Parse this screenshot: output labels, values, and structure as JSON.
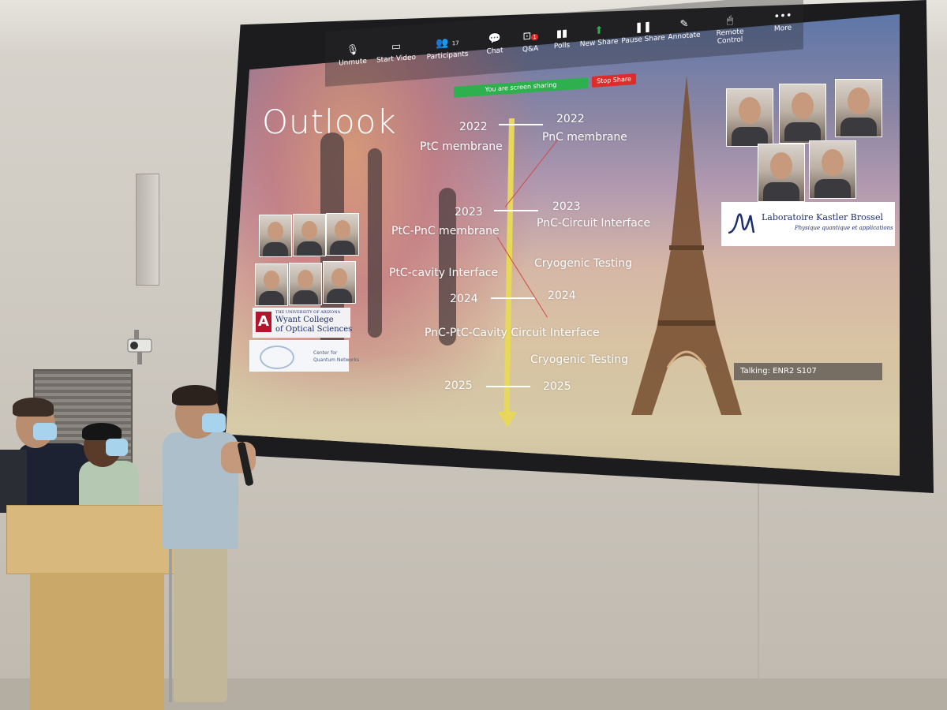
{
  "zoom_toolbar": {
    "items": [
      {
        "label": "Unmute",
        "icon": "mic-muted-icon"
      },
      {
        "label": "Start Video",
        "icon": "video-off-icon"
      },
      {
        "label": "Participants",
        "icon": "participants-icon",
        "count": "17"
      },
      {
        "label": "Chat",
        "icon": "chat-icon"
      },
      {
        "label": "Q&A",
        "icon": "qa-icon",
        "badge": "1"
      },
      {
        "label": "Polls",
        "icon": "polls-icon"
      },
      {
        "label": "New Share",
        "icon": "share-icon"
      },
      {
        "label": "Pause Share",
        "icon": "pause-icon"
      },
      {
        "label": "Annotate",
        "icon": "annotate-icon"
      },
      {
        "label": "Remote Control",
        "icon": "remote-control-icon"
      },
      {
        "label": "More",
        "icon": "more-icon"
      }
    ],
    "sharing_banner": "You are screen sharing",
    "stop_share": "Stop Share"
  },
  "slide": {
    "title": "Outlook",
    "left_items": {
      "year_2022": "2022",
      "ptc_membrane": "PtC membrane",
      "year_2023": "2023",
      "ptc_pnc_membrane": "PtC-PnC membrane",
      "ptc_cavity": "PtC-cavity Interface",
      "year_2024": "2024",
      "year_2025": "2025"
    },
    "right_items": {
      "year_2022": "2022",
      "pnc_membrane": "PnC membrane",
      "year_2023": "2023",
      "pnc_circuit": "PnC-Circuit Interface",
      "cryo_1": "Cryogenic Testing",
      "year_2024": "2024",
      "cryo_2": "Cryogenic Testing",
      "year_2025": "2025"
    },
    "center_item": "PnC-PtC-Cavity Circuit Interface",
    "left_logo_1": {
      "small": "THE UNIVERSITY OF ARIZONA",
      "line1": "Wyant College",
      "line2": "of Optical Sciences"
    },
    "left_logo_2": {
      "line1": "Center for",
      "line2": "Quantum Networks"
    },
    "right_logo": {
      "name": "Laboratoire Kastler Brossel",
      "subtitle": "Physique quantique et applications"
    },
    "talking_label": "Talking: ENR2 S107"
  },
  "colors": {
    "timeline": "#e8d85a",
    "zoom_green": "#2db04d",
    "zoom_red": "#e02b2b",
    "kastler_blue": "#1d2e6e"
  }
}
